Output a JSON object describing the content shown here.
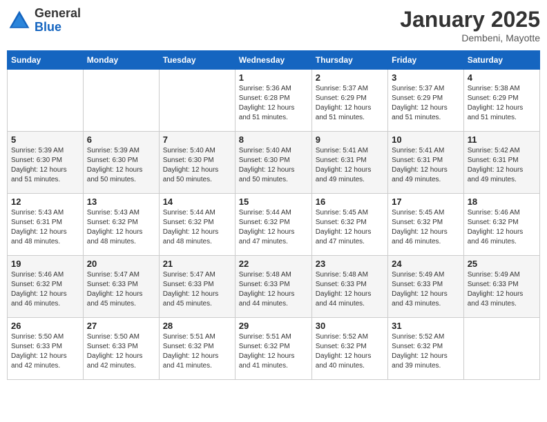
{
  "logo": {
    "general": "General",
    "blue": "Blue"
  },
  "header": {
    "month": "January 2025",
    "location": "Dembeni, Mayotte"
  },
  "weekdays": [
    "Sunday",
    "Monday",
    "Tuesday",
    "Wednesday",
    "Thursday",
    "Friday",
    "Saturday"
  ],
  "weeks": [
    [
      {
        "day": "",
        "info": ""
      },
      {
        "day": "",
        "info": ""
      },
      {
        "day": "",
        "info": ""
      },
      {
        "day": "1",
        "info": "Sunrise: 5:36 AM\nSunset: 6:28 PM\nDaylight: 12 hours\nand 51 minutes."
      },
      {
        "day": "2",
        "info": "Sunrise: 5:37 AM\nSunset: 6:29 PM\nDaylight: 12 hours\nand 51 minutes."
      },
      {
        "day": "3",
        "info": "Sunrise: 5:37 AM\nSunset: 6:29 PM\nDaylight: 12 hours\nand 51 minutes."
      },
      {
        "day": "4",
        "info": "Sunrise: 5:38 AM\nSunset: 6:29 PM\nDaylight: 12 hours\nand 51 minutes."
      }
    ],
    [
      {
        "day": "5",
        "info": "Sunrise: 5:39 AM\nSunset: 6:30 PM\nDaylight: 12 hours\nand 51 minutes."
      },
      {
        "day": "6",
        "info": "Sunrise: 5:39 AM\nSunset: 6:30 PM\nDaylight: 12 hours\nand 50 minutes."
      },
      {
        "day": "7",
        "info": "Sunrise: 5:40 AM\nSunset: 6:30 PM\nDaylight: 12 hours\nand 50 minutes."
      },
      {
        "day": "8",
        "info": "Sunrise: 5:40 AM\nSunset: 6:30 PM\nDaylight: 12 hours\nand 50 minutes."
      },
      {
        "day": "9",
        "info": "Sunrise: 5:41 AM\nSunset: 6:31 PM\nDaylight: 12 hours\nand 49 minutes."
      },
      {
        "day": "10",
        "info": "Sunrise: 5:41 AM\nSunset: 6:31 PM\nDaylight: 12 hours\nand 49 minutes."
      },
      {
        "day": "11",
        "info": "Sunrise: 5:42 AM\nSunset: 6:31 PM\nDaylight: 12 hours\nand 49 minutes."
      }
    ],
    [
      {
        "day": "12",
        "info": "Sunrise: 5:43 AM\nSunset: 6:31 PM\nDaylight: 12 hours\nand 48 minutes."
      },
      {
        "day": "13",
        "info": "Sunrise: 5:43 AM\nSunset: 6:32 PM\nDaylight: 12 hours\nand 48 minutes."
      },
      {
        "day": "14",
        "info": "Sunrise: 5:44 AM\nSunset: 6:32 PM\nDaylight: 12 hours\nand 48 minutes."
      },
      {
        "day": "15",
        "info": "Sunrise: 5:44 AM\nSunset: 6:32 PM\nDaylight: 12 hours\nand 47 minutes."
      },
      {
        "day": "16",
        "info": "Sunrise: 5:45 AM\nSunset: 6:32 PM\nDaylight: 12 hours\nand 47 minutes."
      },
      {
        "day": "17",
        "info": "Sunrise: 5:45 AM\nSunset: 6:32 PM\nDaylight: 12 hours\nand 46 minutes."
      },
      {
        "day": "18",
        "info": "Sunrise: 5:46 AM\nSunset: 6:32 PM\nDaylight: 12 hours\nand 46 minutes."
      }
    ],
    [
      {
        "day": "19",
        "info": "Sunrise: 5:46 AM\nSunset: 6:32 PM\nDaylight: 12 hours\nand 46 minutes."
      },
      {
        "day": "20",
        "info": "Sunrise: 5:47 AM\nSunset: 6:33 PM\nDaylight: 12 hours\nand 45 minutes."
      },
      {
        "day": "21",
        "info": "Sunrise: 5:47 AM\nSunset: 6:33 PM\nDaylight: 12 hours\nand 45 minutes."
      },
      {
        "day": "22",
        "info": "Sunrise: 5:48 AM\nSunset: 6:33 PM\nDaylight: 12 hours\nand 44 minutes."
      },
      {
        "day": "23",
        "info": "Sunrise: 5:48 AM\nSunset: 6:33 PM\nDaylight: 12 hours\nand 44 minutes."
      },
      {
        "day": "24",
        "info": "Sunrise: 5:49 AM\nSunset: 6:33 PM\nDaylight: 12 hours\nand 43 minutes."
      },
      {
        "day": "25",
        "info": "Sunrise: 5:49 AM\nSunset: 6:33 PM\nDaylight: 12 hours\nand 43 minutes."
      }
    ],
    [
      {
        "day": "26",
        "info": "Sunrise: 5:50 AM\nSunset: 6:33 PM\nDaylight: 12 hours\nand 42 minutes."
      },
      {
        "day": "27",
        "info": "Sunrise: 5:50 AM\nSunset: 6:33 PM\nDaylight: 12 hours\nand 42 minutes."
      },
      {
        "day": "28",
        "info": "Sunrise: 5:51 AM\nSunset: 6:32 PM\nDaylight: 12 hours\nand 41 minutes."
      },
      {
        "day": "29",
        "info": "Sunrise: 5:51 AM\nSunset: 6:32 PM\nDaylight: 12 hours\nand 41 minutes."
      },
      {
        "day": "30",
        "info": "Sunrise: 5:52 AM\nSunset: 6:32 PM\nDaylight: 12 hours\nand 40 minutes."
      },
      {
        "day": "31",
        "info": "Sunrise: 5:52 AM\nSunset: 6:32 PM\nDaylight: 12 hours\nand 39 minutes."
      },
      {
        "day": "",
        "info": ""
      }
    ]
  ]
}
